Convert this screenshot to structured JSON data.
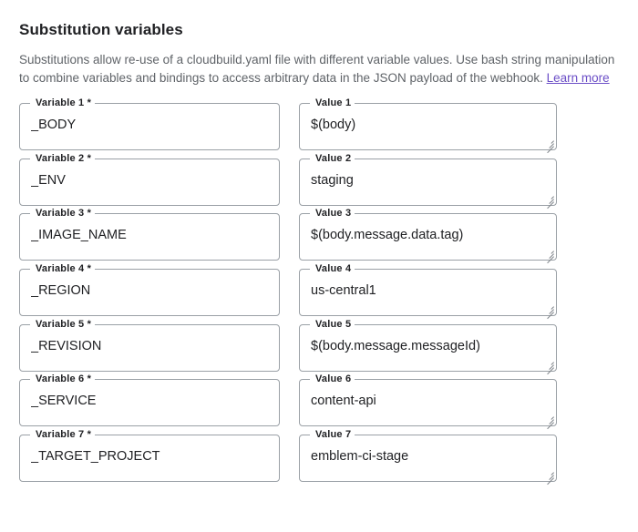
{
  "section": {
    "title": "Substitution variables",
    "description_before_link": "Substitutions allow re-use of a cloudbuild.yaml file with different variable values. Use bash string manipulation to combine variables and bindings to access arbitrary data in the JSON payload of the webhook. ",
    "link_label": "Learn more",
    "link_color": "#6b4ec7"
  },
  "rows": [
    {
      "variable_label": "Variable 1 *",
      "variable_value": "_BODY",
      "value_label": "Value 1",
      "value_value": "$(body)"
    },
    {
      "variable_label": "Variable 2 *",
      "variable_value": "_ENV",
      "value_label": "Value 2",
      "value_value": "staging"
    },
    {
      "variable_label": "Variable 3 *",
      "variable_value": "_IMAGE_NAME",
      "value_label": "Value 3",
      "value_value": "$(body.message.data.tag)"
    },
    {
      "variable_label": "Variable 4 *",
      "variable_value": "_REGION",
      "value_label": "Value 4",
      "value_value": "us-central1"
    },
    {
      "variable_label": "Variable 5 *",
      "variable_value": "_REVISION",
      "value_label": "Value 5",
      "value_value": "$(body.message.messageId)"
    },
    {
      "variable_label": "Variable 6 *",
      "variable_value": "_SERVICE",
      "value_label": "Value 6",
      "value_value": "content-api"
    },
    {
      "variable_label": "Variable 7 *",
      "variable_value": "_TARGET_PROJECT",
      "value_label": "Value 7",
      "value_value": "emblem-ci-stage"
    }
  ]
}
